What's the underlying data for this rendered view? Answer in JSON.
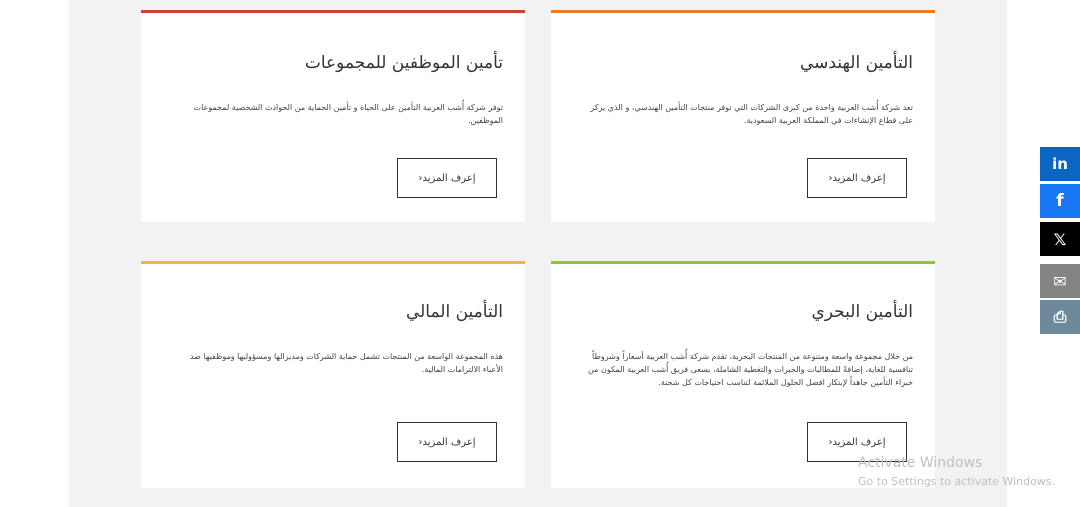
{
  "cards": [
    {
      "title": "التأمين الهندسي",
      "desc": "تعد شركة أُشب العربية واحدة من كبرى الشركات التي توفر منتجات التأمين الهندسي، و الذي يركز على قطاع الإنشاءات في المملكة العربية السعودية.",
      "button": "إعرف المزيد‹",
      "accent": "#e8792b"
    },
    {
      "title": "تأمين الموظفين للمجموعات",
      "desc": "توفر شركة أُشب العربية التأمين على الحياة و تأمين الحماية من الحوادث الشخصية لمجموعات الموظفين.",
      "button": "إعرف المزيد‹",
      "accent": "#c9423c"
    },
    {
      "title": "التأمين البحري",
      "desc": "من خلال مجموعة واسعة ومتنوعة من المنتجات البحرية، تقدم شركة أُشب العربية أسعاراً وشروطاً تنافسية للغاية، إضافةً للمطالبات والخبرات والتغطية الشاملة، يسعى فريق أُشب العربية المكون من خبراء التأمين جاهداً لإبتكار افضل الحلول الملائمة لتناسب احتياجات كل شحنة.",
      "button": "إعرف المزيد‹",
      "accent": "#8cc63f"
    },
    {
      "title": "التأمين المالي",
      "desc": "هذه المجموعة الواسعة من المنتجات تشمل حماية الشركات ومديرالها ومسؤوليها وموظفيها ضد الأعباء الالتزامات المالية.",
      "button": "إعرف المزيد‹",
      "accent": "#f0b73d"
    }
  ],
  "share": [
    {
      "icon": "linkedin-icon",
      "glyph": "in",
      "color": "#0a66c2"
    },
    {
      "icon": "facebook-icon",
      "glyph": "f",
      "color": "#1877f2"
    },
    {
      "icon": "x-icon",
      "glyph": "𝕏",
      "color": "#000000"
    },
    {
      "icon": "email-icon",
      "glyph": "✉",
      "color": "#848484"
    },
    {
      "icon": "print-icon",
      "glyph": "⎙",
      "color": "#6e8a9a"
    }
  ],
  "watermark": {
    "line1": "Activate Windows",
    "line2": "Go to Settings to activate Windows."
  }
}
